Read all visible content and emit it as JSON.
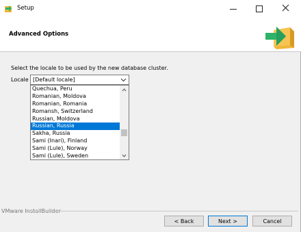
{
  "window": {
    "title": "Setup",
    "icons": {
      "app": "installer-app-icon",
      "minimize": "minimize-icon",
      "maximize": "maximize-icon",
      "close": "close-icon"
    }
  },
  "header": {
    "title": "Advanced Options",
    "icon": "installer-arrow-box-icon"
  },
  "main": {
    "prompt": "Select the locale to be used by the new database cluster.",
    "locale_label": "Locale",
    "locale_value": "[Default locale]",
    "locale_options": [
      "Quechua, Peru",
      "Romanian, Moldova",
      "Romanian, Romania",
      "Romansh, Switzerland",
      "Russian, Moldova",
      "Russian, Russia",
      "Sakha, Russia",
      "Sami (Inari), Finland",
      "Sami (Lule), Norway",
      "Sami (Lule), Sweden"
    ],
    "selected_option": "Russian, Russia"
  },
  "footer": {
    "brand": "VMware InstallBuilder",
    "back_label": "< Back",
    "next_label": "Next >",
    "cancel_label": "Cancel"
  },
  "colors": {
    "selection": "#0078d7",
    "window_bg": "#f0f0f0",
    "header_bg": "#ffffff",
    "icon_green": "#2fb36a",
    "icon_box": "#f0b63c"
  }
}
